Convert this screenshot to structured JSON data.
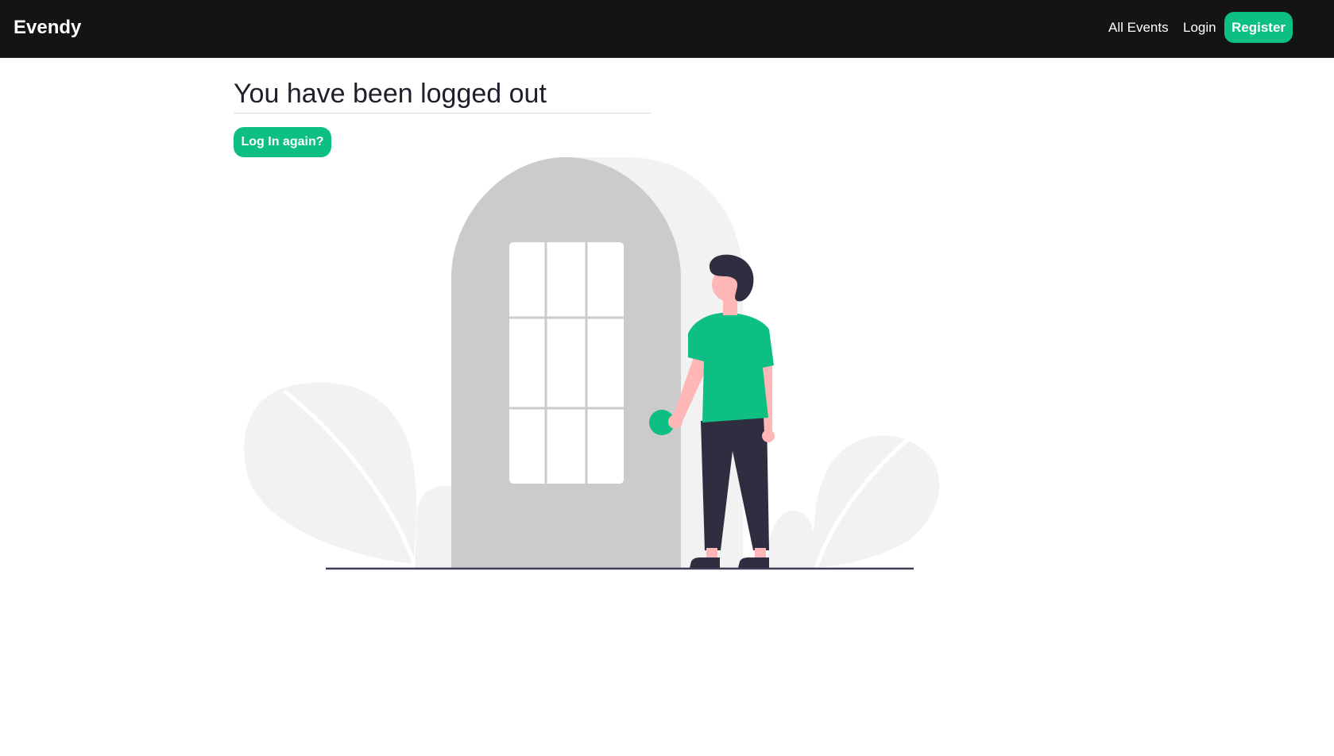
{
  "navbar": {
    "brand": "Evendy",
    "links": {
      "all_events": "All Events",
      "login": "Login",
      "register": "Register"
    }
  },
  "main": {
    "title": "You have been logged out",
    "relogin_label": "Log In again?"
  },
  "colors": {
    "navbar_bg": "#141414",
    "accent": "#0dbf82",
    "title_text": "#1e1f2b",
    "door": "#cbcbcb",
    "door_shadow": "#f2f2f2",
    "pants": "#2f2e41",
    "skin": "#ffb6b6"
  }
}
